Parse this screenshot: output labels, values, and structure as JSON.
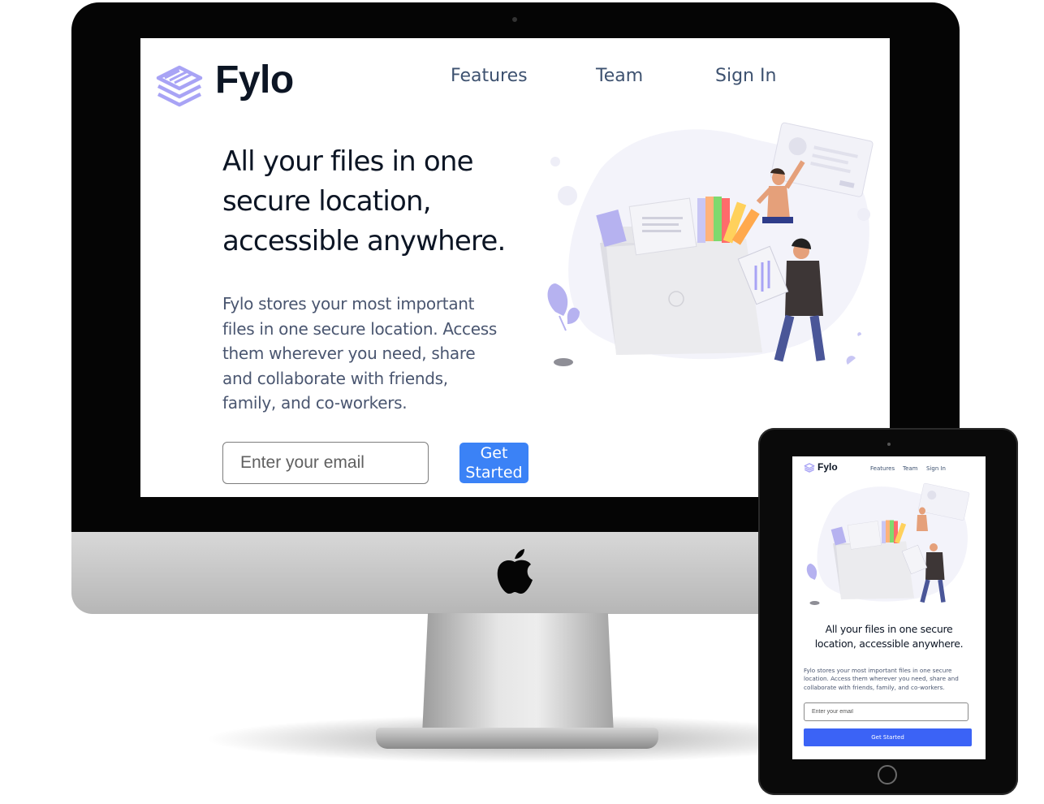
{
  "desktop": {
    "logo_text": "Fylo",
    "nav": [
      "Features",
      "Team",
      "Sign In"
    ],
    "hero_title_lines": [
      "All your files in one",
      "secure location,",
      "accessible anywhere."
    ],
    "hero_desc_lines": [
      "Fylo stores your most important",
      "files in one secure location. Access",
      "them wherever you need, share",
      "and collaborate with friends,",
      "family, and co-workers."
    ],
    "email_placeholder": "Enter your email",
    "cta_lines": [
      "Get",
      "Started"
    ]
  },
  "tablet": {
    "logo_text": "Fylo",
    "nav": [
      "Features",
      "Team",
      "Sign In"
    ],
    "hero_title_lines": [
      "All your files in one secure",
      "location, accessible anywhere."
    ],
    "hero_desc_lines": [
      "Fylo stores your most important files in one secure",
      "location. Access them wherever you need, share and",
      "collaborate with friends, family, and co-workers."
    ],
    "email_placeholder": "Enter your email",
    "cta": "Get Started"
  },
  "colors": {
    "accent_blue": "#3b82f6",
    "dark_navy": "#0c1524",
    "nav_text": "#3e5270",
    "logo_purple": "#a8a3f5"
  },
  "icons": [
    "fylo-logo-icon",
    "apple-logo-icon",
    "hero-illustration"
  ]
}
